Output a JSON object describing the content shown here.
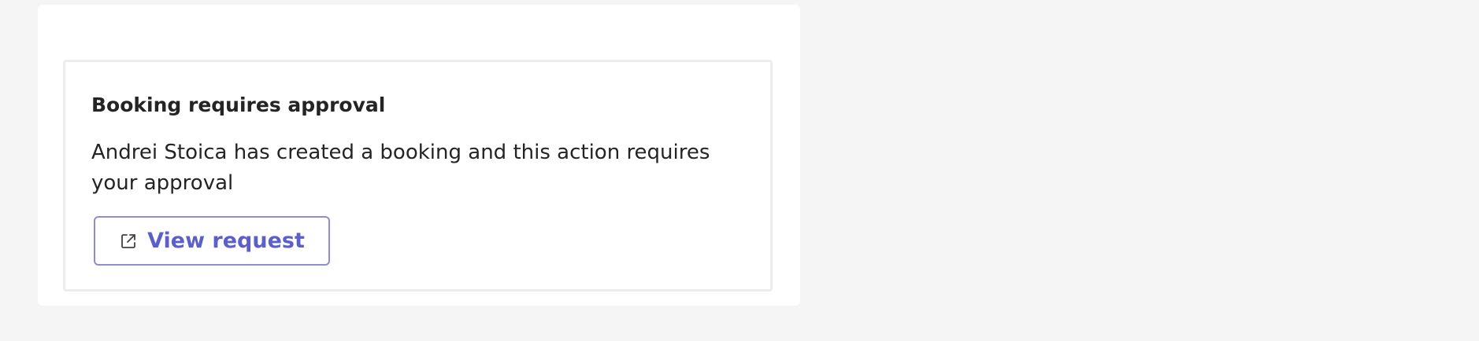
{
  "notification": {
    "title": "Booking requires approval",
    "body": "Andrei Stoica has created a booking and this action requires your approval",
    "action": {
      "label": "View request",
      "icon": "open-external-icon"
    }
  },
  "colors": {
    "background": "#f5f5f5",
    "card": "#ffffff",
    "card_border": "#ececec",
    "accent": "#5b5fc7",
    "button_border": "#8d8ecf",
    "text": "#242424"
  }
}
